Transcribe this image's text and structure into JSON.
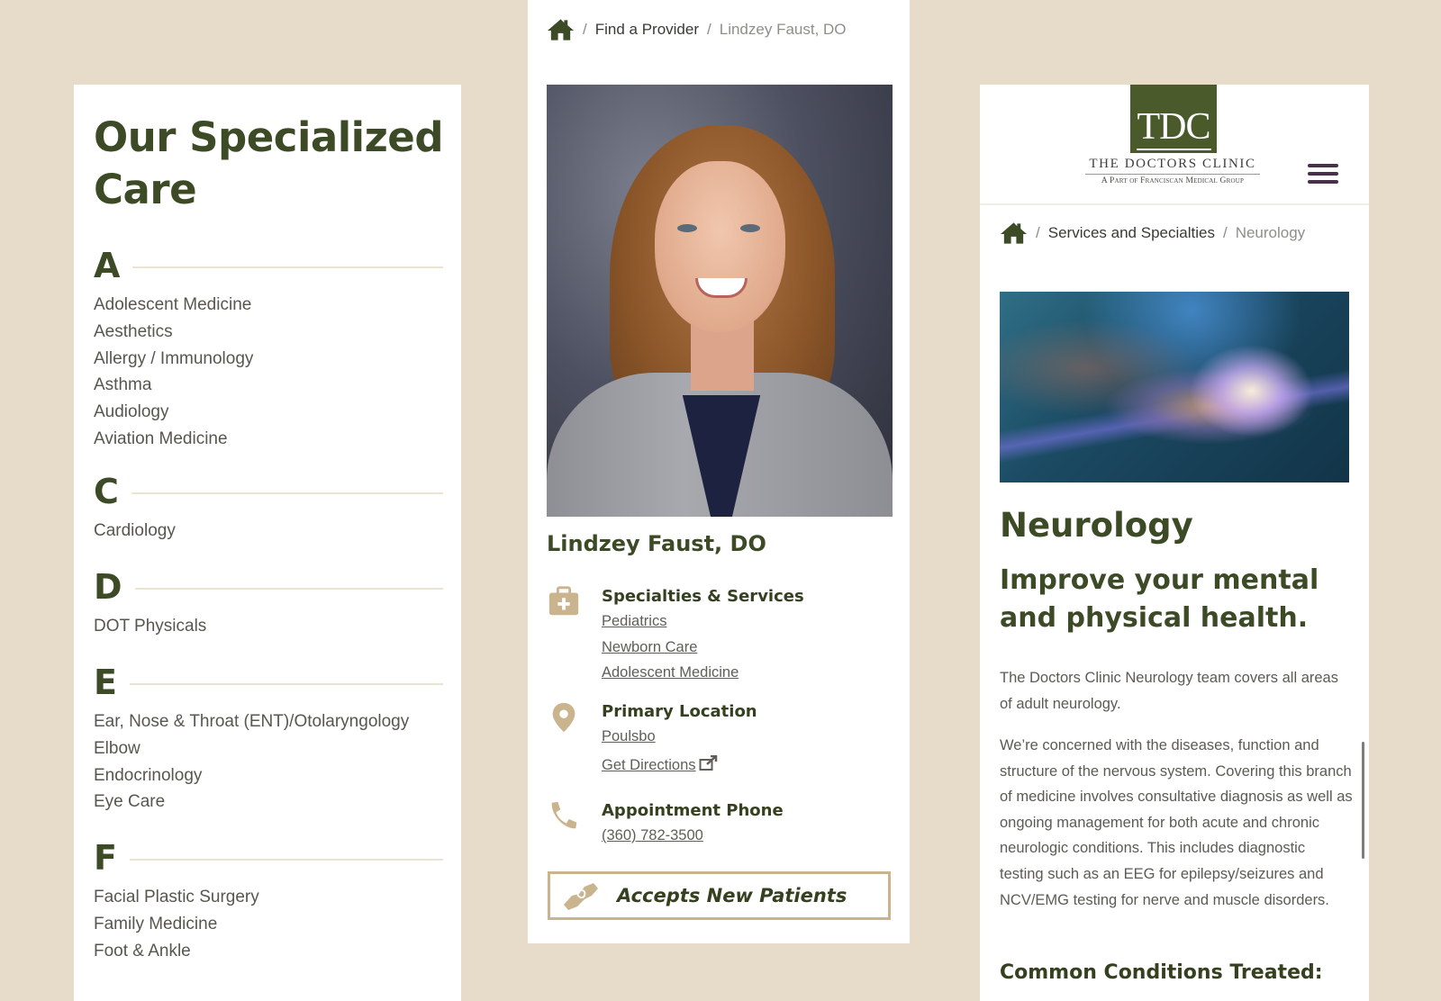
{
  "colors": {
    "page_background": "#e6dcc9",
    "brand_green": "#3c4a26",
    "accent_tan": "#c9b48d",
    "menu_purple": "#4a2f4a"
  },
  "specialties_panel": {
    "title": "Our Specialized Care",
    "groups": [
      {
        "letter": "A",
        "items": [
          "Adolescent Medicine",
          "Aesthetics",
          "Allergy / Immunology",
          "Asthma",
          "Audiology",
          "Aviation Medicine"
        ]
      },
      {
        "letter": "C",
        "items": [
          "Cardiology"
        ]
      },
      {
        "letter": "D",
        "items": [
          "DOT Physicals"
        ]
      },
      {
        "letter": "E",
        "items": [
          "Ear, Nose & Throat (ENT)/Otolaryngology",
          "Elbow",
          "Endocrinology",
          "Eye Care"
        ]
      },
      {
        "letter": "F",
        "items": [
          "Facial Plastic Surgery",
          "Family Medicine",
          "Foot & Ankle"
        ]
      }
    ]
  },
  "provider_panel": {
    "breadcrumb": {
      "home_icon": "home-icon",
      "separator": "/",
      "items": [
        "Find a Provider",
        "Lindzey Faust, DO"
      ]
    },
    "photo_alt": "Portrait of Lindzey Faust, DO",
    "name": "Lindzey Faust, DO",
    "specialties": {
      "icon": "medical-kit-icon",
      "title": "Specialties & Services",
      "links": [
        "Pediatrics",
        "Newborn Care",
        "Adolescent Medicine"
      ]
    },
    "location": {
      "icon": "map-pin-icon",
      "title": "Primary Location",
      "city": "Poulsbo",
      "directions_label": "Get Directions",
      "directions_icon": "external-link-icon"
    },
    "phone": {
      "icon": "phone-icon",
      "title": "Appointment Phone",
      "number": "(360) 782-3500"
    },
    "accepts_badge": {
      "icon": "handshake-icon",
      "label": "Accepts New Patients"
    }
  },
  "neurology_panel": {
    "logo": {
      "monogram": "TDC",
      "name": "The Doctors Clinic",
      "tagline": "A Part of Franciscan Medical Group"
    },
    "menu_icon": "hamburger-menu-icon",
    "breadcrumb": {
      "home_icon": "home-icon",
      "separator": "/",
      "items": [
        "Services and Specialties",
        "Neurology"
      ]
    },
    "hero_alt": "Illustration of a glowing neuron",
    "heading": "Neurology",
    "subheading": "Improve your mental and physical health.",
    "paragraphs": [
      "The Doctors Clinic Neurology team covers all areas of adult neurology.",
      "We’re concerned with the diseases, function and structure of the nervous system. Covering this branch of medicine involves consultative diagnosis as well as ongoing management for both acute and chronic neurologic conditions. This includes diagnostic testing such as an EEG for epilepsy/seizures and NCV/EMG testing for nerve and muscle disorders."
    ],
    "section_heading": "Common Conditions Treated:"
  }
}
